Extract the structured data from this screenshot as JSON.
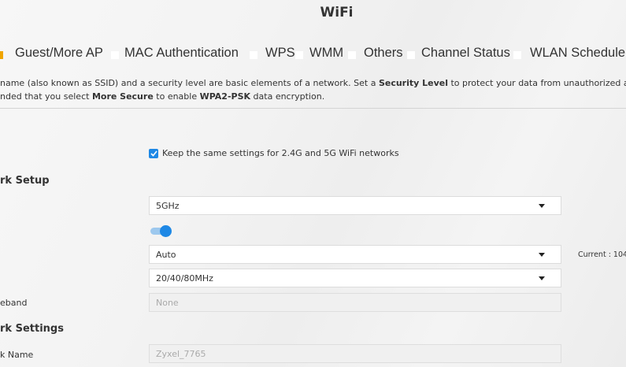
{
  "page": {
    "title": "WiFi"
  },
  "tabs": [
    {
      "label": "Guest/More AP",
      "active": false
    },
    {
      "label": "MAC Authentication",
      "active": false
    },
    {
      "label": "WPS",
      "active": false
    },
    {
      "label": "WMM",
      "active": false
    },
    {
      "label": "Others",
      "active": false
    },
    {
      "label": "Channel Status",
      "active": false
    },
    {
      "label": "WLAN Scheduler",
      "active": false
    }
  ],
  "description": {
    "line1_a": "name (also known as SSID) and a security level are basic elements of a network. Set a ",
    "line1_b": "Security Level",
    "line1_c": " to protect your data from unauthorized access or dar",
    "line2_a": "nded that you select ",
    "line2_b": "More Secure",
    "line2_c": " to enable ",
    "line2_d": "WPA2-PSK",
    "line2_e": " data encryption."
  },
  "keep_same": {
    "label": "Keep the same settings for 2.4G and 5G WiFi networks",
    "checked": true
  },
  "network_setup": {
    "heading": "rk Setup",
    "band_select": "5GHz",
    "wifi_enabled": true,
    "channel_select": "Auto",
    "current_channel": "Current : 104",
    "bandwidth_select": "20/40/80MHz",
    "sideband_label": "eband",
    "sideband_value": "None"
  },
  "network_settings": {
    "heading": "rk Settings",
    "name_label": "k Name",
    "name_value": "Zyxel_7765"
  },
  "colors": {
    "accent": "#1e88e5",
    "tab_marker": "#f0a500"
  }
}
